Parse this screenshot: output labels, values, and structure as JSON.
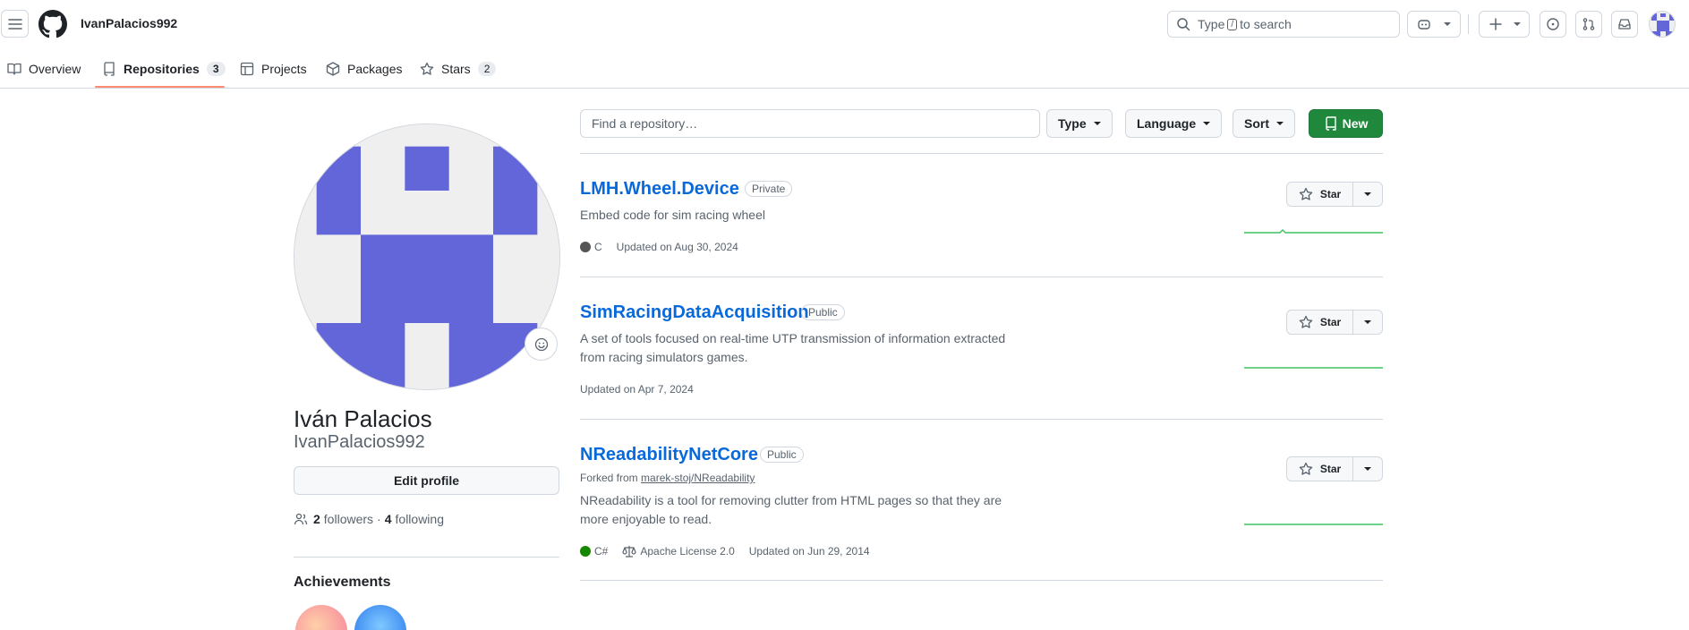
{
  "header": {
    "username": "IvanPalacios992",
    "search_pre": "Type",
    "search_key": "/",
    "search_post": "to search"
  },
  "tabs": [
    {
      "label": "Overview"
    },
    {
      "label": "Repositories",
      "count": "3"
    },
    {
      "label": "Projects"
    },
    {
      "label": "Packages"
    },
    {
      "label": "Stars",
      "count": "2"
    }
  ],
  "profile": {
    "full_name": "Iván Palacios",
    "login": "IvanPalacios992",
    "edit_label": "Edit profile",
    "followers_count": "2",
    "followers_label": "followers",
    "sep": "·",
    "following_count": "4",
    "following_label": "following",
    "achievements_title": "Achievements"
  },
  "filters": {
    "find_placeholder": "Find a repository…",
    "type_label": "Type",
    "language_label": "Language",
    "sort_label": "Sort",
    "new_label": "New"
  },
  "repos": [
    {
      "name": "LMH.Wheel.Device",
      "visibility": "Private",
      "description": "Embed code for sim racing wheel",
      "language": "C",
      "language_color": "#555555",
      "updated": "Updated on Aug 30, 2024",
      "star_label": "Star"
    },
    {
      "name": "SimRacingDataAcquisition",
      "visibility": "Public",
      "description": "A set of tools focused on real-time UTP transmission of information extracted from racing simulators games.",
      "updated": "Updated on Apr 7, 2024",
      "star_label": "Star"
    },
    {
      "name": "NReadabilityNetCore",
      "visibility": "Public",
      "forked_prefix": "Forked from",
      "forked_from": "marek-stoj/NReadability",
      "description": "NReadability is a tool for removing clutter from HTML pages so that they are more enjoyable to read.",
      "language": "C#",
      "language_color": "#178600",
      "license": "Apache License 2.0",
      "updated": "Updated on Jun 29, 2014",
      "star_label": "Star"
    }
  ],
  "colors": {
    "accent": "#0969da",
    "primary_button": "#1f883d",
    "avatar_purple": "#6266d8",
    "tab_underline": "#fd8c73",
    "sparkline": "#40c463"
  }
}
